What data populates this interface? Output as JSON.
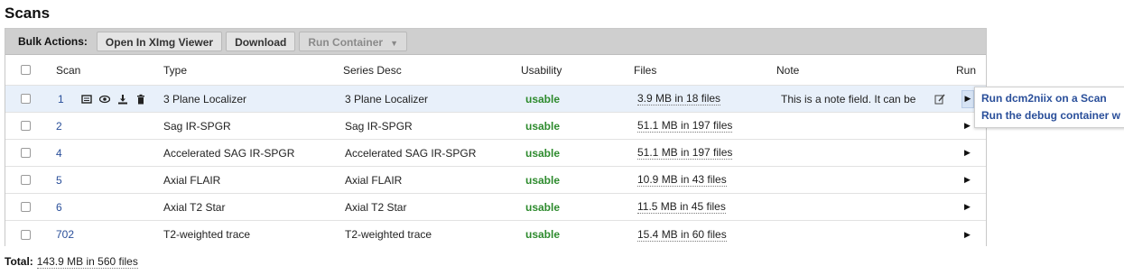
{
  "title": "Scans",
  "toolbar": {
    "bulk_label": "Bulk Actions:",
    "buttons": [
      "Open In XImg Viewer",
      "Download",
      "Run Container"
    ]
  },
  "columns": [
    "Scan",
    "Type",
    "Series Desc",
    "Usability",
    "Files",
    "Note",
    "Run"
  ],
  "rows": [
    {
      "scan": "1",
      "type": "3 Plane Localizer",
      "series": "3 Plane Localizer",
      "usability": "usable",
      "files": "3.9 MB in 18 files",
      "note": "This is a note field. It can be"
    },
    {
      "scan": "2",
      "type": "Sag IR-SPGR",
      "series": "Sag IR-SPGR",
      "usability": "usable",
      "files": "51.1 MB in 197 files",
      "note": ""
    },
    {
      "scan": "4",
      "type": "Accelerated SAG IR-SPGR",
      "series": "Accelerated SAG IR-SPGR",
      "usability": "usable",
      "files": "51.1 MB in 197 files",
      "note": ""
    },
    {
      "scan": "5",
      "type": "Axial FLAIR",
      "series": "Axial FLAIR",
      "usability": "usable",
      "files": "10.9 MB in 43 files",
      "note": ""
    },
    {
      "scan": "6",
      "type": "Axial T2 Star",
      "series": "Axial T2 Star",
      "usability": "usable",
      "files": "11.5 MB in 45 files",
      "note": ""
    },
    {
      "scan": "702",
      "type": "T2-weighted trace",
      "series": "T2-weighted trace",
      "usability": "usable",
      "files": "15.4 MB in 60 files",
      "note": ""
    }
  ],
  "run_menu": [
    "Run dcm2niix on a Scan",
    "Run the debug container w"
  ],
  "total": {
    "label": "Total:",
    "value": "143.9 MB in 560 files"
  }
}
